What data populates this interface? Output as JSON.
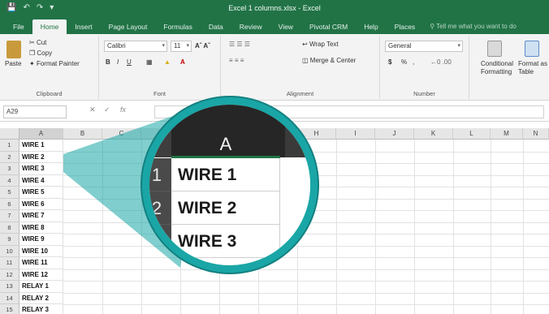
{
  "window": {
    "title": "Excel 1 columns.xlsx - Excel",
    "qat_icons": [
      "save-icon",
      "undo-icon",
      "redo-icon",
      "customize-icon"
    ]
  },
  "tabs": [
    "File",
    "Home",
    "Insert",
    "Page Layout",
    "Formulas",
    "Data",
    "Review",
    "View",
    "Pivotal CRM",
    "Help",
    "Places"
  ],
  "tell_me": "Tell me what you want to do",
  "ribbon": {
    "clipboard": {
      "paste": "Paste",
      "cut": "Cut",
      "copy": "Copy",
      "format_painter": "Format Painter",
      "label": "Clipboard"
    },
    "font": {
      "name": "Calibri",
      "size": "11",
      "label": "Font",
      "bold": "B",
      "italic": "I",
      "underline": "U"
    },
    "alignment": {
      "wrap_text": "Wrap Text",
      "merge_center": "Merge & Center",
      "label": "Alignment"
    },
    "number": {
      "format": "General",
      "currency": "$",
      "percent": "%",
      "comma": ",",
      "label": "Number"
    },
    "styles": {
      "conditional": "Conditional",
      "formatting": "Formatting",
      "format_as": "Format as",
      "table": "Table"
    }
  },
  "formula_bar": {
    "name_box": "A29",
    "fx": "fx"
  },
  "grid": {
    "columns": [
      "A",
      "B",
      "C",
      "D",
      "E",
      "F",
      "G",
      "H",
      "I",
      "J",
      "K",
      "L",
      "M",
      "N"
    ],
    "rows": [
      {
        "n": "1",
        "a": "WIRE 1"
      },
      {
        "n": "2",
        "a": "WIRE 2"
      },
      {
        "n": "3",
        "a": "WIRE 3"
      },
      {
        "n": "4",
        "a": "WIRE 4"
      },
      {
        "n": "5",
        "a": "WIRE 5"
      },
      {
        "n": "6",
        "a": "WIRE 6"
      },
      {
        "n": "7",
        "a": "WIRE 7"
      },
      {
        "n": "8",
        "a": "WIRE 8"
      },
      {
        "n": "9",
        "a": "WIRE 9"
      },
      {
        "n": "10",
        "a": "WIRE 10"
      },
      {
        "n": "11",
        "a": "WIRE 11"
      },
      {
        "n": "12",
        "a": "WIRE 12"
      },
      {
        "n": "13",
        "a": "RELAY 1"
      },
      {
        "n": "14",
        "a": "RELAY 2"
      },
      {
        "n": "15",
        "a": "RELAY 3"
      }
    ]
  },
  "magnifier": {
    "column": "A",
    "rows": [
      {
        "n": "1",
        "a": "WIRE 1"
      },
      {
        "n": "2",
        "a": "WIRE 2"
      },
      {
        "n": "3",
        "a": "WIRE 3"
      }
    ],
    "ring_color": "#1aa6a6"
  },
  "colors": {
    "excel_green": "#217346",
    "ribbon_bg": "#f3f3f3",
    "header_bg": "#e6e6e6"
  }
}
